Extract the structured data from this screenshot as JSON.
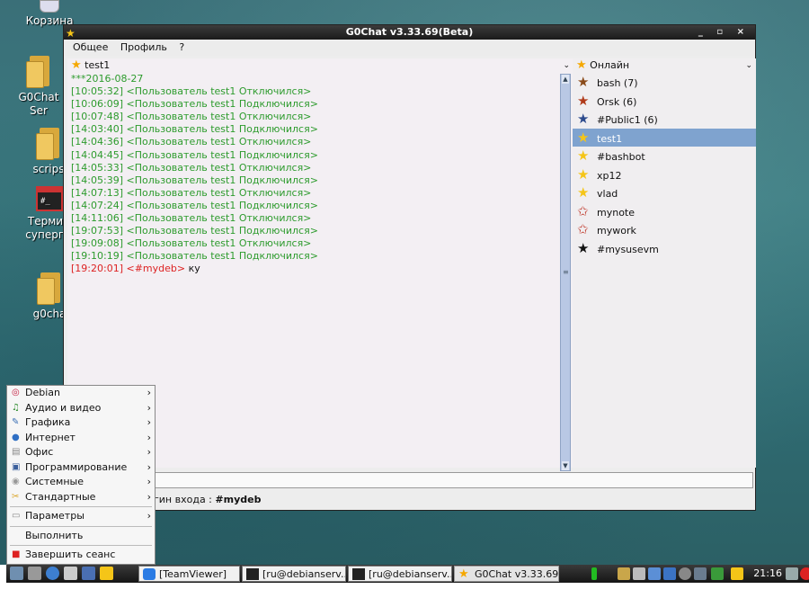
{
  "desktop": {
    "icons": [
      {
        "label": "Корзина"
      },
      {
        "label": "G0ChatSer"
      },
      {
        "label": "scrips"
      },
      {
        "label": "Терми суперп"
      },
      {
        "label": "g0cha"
      }
    ]
  },
  "window": {
    "title": "G0Chat v3.33.69(Beta)",
    "controls": "_ ▫ ×",
    "menu": [
      "Общее",
      "Профиль",
      "?"
    ]
  },
  "chat": {
    "channel": "test1",
    "date_line": "***2016-08-27",
    "lines": [
      {
        "time": "[10:05:32]",
        "text": "<Пользователь test1 Отключился>"
      },
      {
        "time": "[10:06:09]",
        "text": "<Пользователь test1 Подключился>"
      },
      {
        "time": "[10:07:48]",
        "text": "<Пользователь test1 Отключился>"
      },
      {
        "time": "[14:03:40]",
        "text": "<Пользователь test1 Подключился>"
      },
      {
        "time": "[14:04:36]",
        "text": "<Пользователь test1 Отключился>"
      },
      {
        "time": "[14:04:45]",
        "text": "<Пользователь test1 Подключился>"
      },
      {
        "time": "[14:05:33]",
        "text": "<Пользователь test1 Отключился>"
      },
      {
        "time": "[14:05:39]",
        "text": "<Пользователь test1 Подключился>"
      },
      {
        "time": "[14:07:13]",
        "text": "<Пользователь test1 Отключился>"
      },
      {
        "time": "[14:07:24]",
        "text": "<Пользователь test1 Подключился>"
      },
      {
        "time": "[14:11:06]",
        "text": "<Пользователь test1 Отключился>"
      },
      {
        "time": "[19:07:53]",
        "text": "<Пользователь test1 Подключился>"
      },
      {
        "time": "[19:09:08]",
        "text": "<Пользователь test1 Отключился>"
      },
      {
        "time": "[19:10:19]",
        "text": "<Пользователь test1 Подключился>"
      }
    ],
    "message": {
      "time": "[19:20:01]",
      "nick": "<#mydeb>",
      "body": "ку"
    }
  },
  "users": {
    "header": "Онлайн",
    "list": [
      {
        "name": "bash (7)",
        "icon": "star-icon",
        "color": "#8a4b1a"
      },
      {
        "name": "Orsk (6)",
        "icon": "star-icon",
        "color": "#b03a1a"
      },
      {
        "name": "#Public1 (6)",
        "icon": "star-icon",
        "color": "#2c4a8c"
      },
      {
        "name": "test1",
        "icon": "star-icon",
        "color": "#f5c518",
        "selected": true
      },
      {
        "name": "#bashbot",
        "icon": "star-icon",
        "color": "#f5c518"
      },
      {
        "name": "xp12",
        "icon": "star-icon",
        "color": "#f5c518"
      },
      {
        "name": "vlad",
        "icon": "star-icon",
        "color": "#f5c518"
      },
      {
        "name": "mynote",
        "icon": "star-outline-icon",
        "color": "#c0392b"
      },
      {
        "name": "mywork",
        "icon": "star-outline-icon",
        "color": "#c0392b"
      },
      {
        "name": "#mysusevm",
        "icon": "star-icon",
        "color": "#111111"
      }
    ]
  },
  "status": {
    "label": "гин входа : ",
    "value": "#mydeb"
  },
  "start_menu": {
    "items": [
      {
        "label": "Debian",
        "submenu": true
      },
      {
        "label": "Аудио и видео",
        "submenu": true
      },
      {
        "label": "Графика",
        "submenu": true
      },
      {
        "label": "Интернет",
        "submenu": true
      },
      {
        "label": "Офис",
        "submenu": true
      },
      {
        "label": "Программирование",
        "submenu": true
      },
      {
        "label": "Системные",
        "submenu": true
      },
      {
        "label": "Стандартные",
        "submenu": true
      }
    ],
    "settings": "Параметры",
    "run": "Выполнить",
    "logout": "Завершить сеанс"
  },
  "taskbar": {
    "tasks": [
      {
        "label": "[TeamViewer]"
      },
      {
        "label": "[ru@debianserv..."
      },
      {
        "label": "[ru@debianserv..."
      },
      {
        "label": "G0Chat v3.33.69..."
      }
    ],
    "clock": "21:16"
  }
}
